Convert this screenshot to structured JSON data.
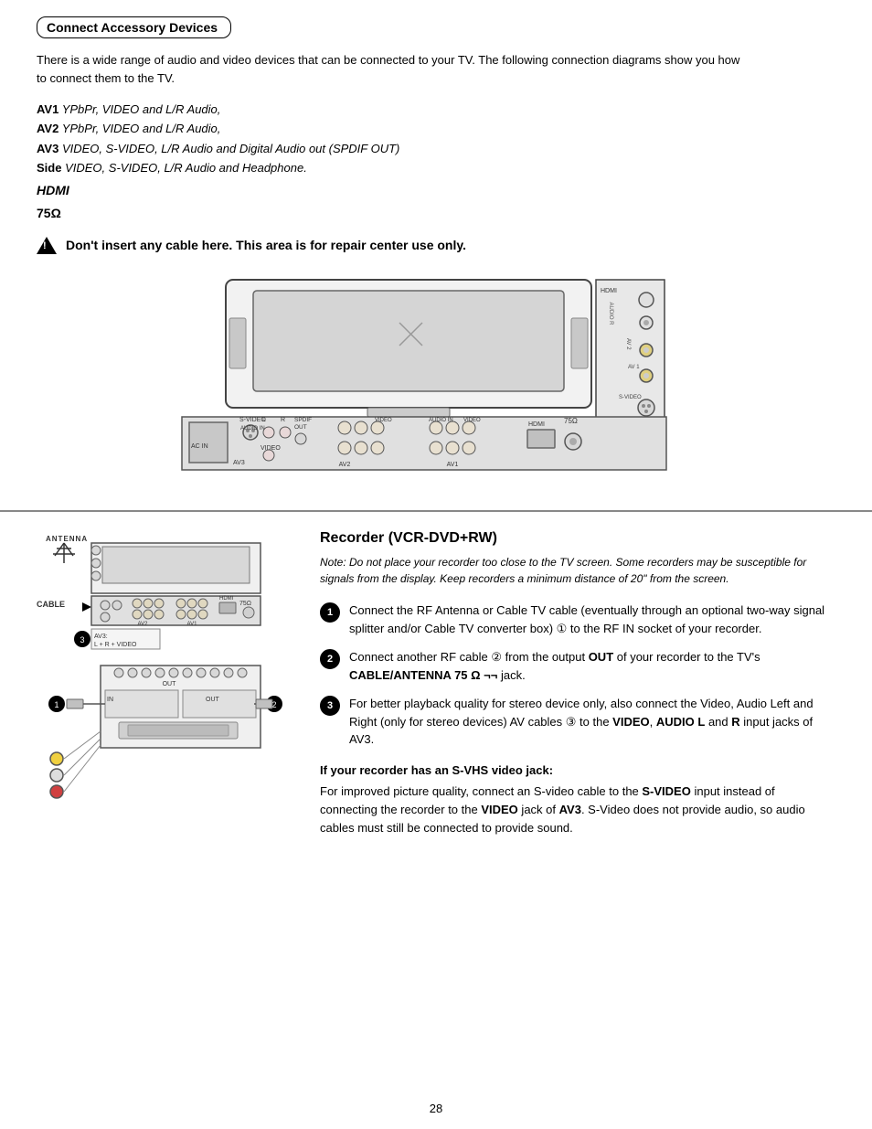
{
  "page": {
    "number": "28"
  },
  "top_section": {
    "title": "Connect Accessory Devices",
    "intro": "There is a wide range of audio and video devices that can be connected to your TV. The following connection diagrams show you how to connect them to the TV.",
    "connections": [
      {
        "id": "AV1",
        "desc": "YPbPr, VIDEO and L/R Audio,"
      },
      {
        "id": "AV2",
        "desc": "YPbPr, VIDEO and L/R Audio,"
      },
      {
        "id": "AV3",
        "desc": "VIDEO, S-VIDEO, L/R Audio and Digital Audio out (SPDIF OUT)"
      },
      {
        "id": "Side",
        "desc": "VIDEO, S-VIDEO, L/R Audio and Headphone."
      }
    ],
    "hdmi_line": "HDMI",
    "ohm_line": "75Ω",
    "warning": "Don't insert any cable here.  This area is for  repair center use only."
  },
  "bottom_section": {
    "antenna_label": "ANTENNA",
    "cable_label": "CABLE",
    "recorder_title": "Recorder (VCR-DVD+RW)",
    "note": "Note: Do not place your recorder too close to the TV screen. Some recorders may be susceptible for signals from the display. Keep recorders a minimum distance of 20\" from the screen.",
    "steps": [
      {
        "num": "1",
        "text": "Connect the RF Antenna or Cable TV cable (eventually through an optional two-way signal splitter and/or Cable TV converter box) ① to the RF IN socket of your recorder."
      },
      {
        "num": "2",
        "text": "Connect another RF cable ② from the output OUT of your recorder to the TV's CABLE/ANTENNA 75 Ω ¬¬ jack."
      },
      {
        "num": "3",
        "text": "For better playback quality for stereo device only, also connect the Video, Audio Left and Right (only for stereo devices) AV cables ③ to the VIDEO, AUDIO L and R input jacks of AV3."
      }
    ],
    "svhs_title": "If your recorder has an S-VHS video jack:",
    "svhs_text": "For improved picture quality, connect an S-video cable to the S-VIDEO input instead of connecting the recorder to the VIDEO jack of AV3. S-Video does not provide audio, so audio cables must still be connected to provide sound.",
    "vcr_label": "AV3:\nL + R + VIDEO",
    "out_label": "OUT",
    "in_label": "IN",
    "av1_label": "AV1",
    "av2_label": "AV2",
    "hdmi_label": "HDMI"
  }
}
